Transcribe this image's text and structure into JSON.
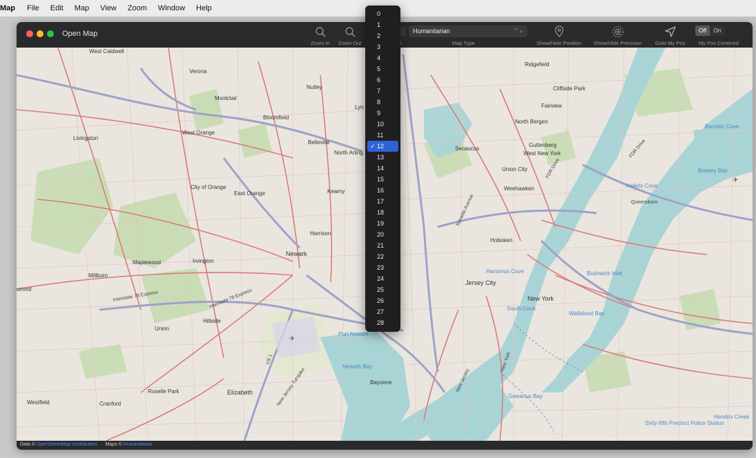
{
  "menubar": {
    "app": "Map",
    "items": [
      "File",
      "Edit",
      "Map",
      "View",
      "Zoom",
      "Window",
      "Help"
    ]
  },
  "window": {
    "title": "Open Map"
  },
  "toolbar": {
    "zoom_in": "Zoom In",
    "zoom_out": "Zoom Out",
    "map_type_value": "Humanitarian",
    "map_type_label": "Map Type",
    "show_hide_position": "Show/Hide Position",
    "show_hide_precision": "Show/Hide Precision",
    "goto_my_pos": "Goto My Pos",
    "segment_off": "Off",
    "segment_on": "On",
    "my_pos_centered": "My Pos Centered",
    "zoom_level_partial": "l"
  },
  "zoom_dropdown": {
    "selected": "12",
    "check": "✓",
    "options": [
      "0",
      "1",
      "2",
      "3",
      "4",
      "5",
      "6",
      "7",
      "8",
      "9",
      "10",
      "11",
      "12",
      "13",
      "14",
      "15",
      "16",
      "17",
      "18",
      "19",
      "20",
      "21",
      "22",
      "23",
      "24",
      "25",
      "26",
      "27",
      "28"
    ]
  },
  "map": {
    "labels": {
      "west_caldwell": "West Caldwell",
      "verona": "Verona",
      "nutley": "Nutley",
      "montclair": "Montclair",
      "bloomfield": "Bloomfield",
      "west_orange": "West Orange",
      "livingston": "Livingston",
      "belleville": "Belleville",
      "north_arlington": "North Arling",
      "city_of_orange": "City of Orange",
      "east_orange": "East Orange",
      "kearny": "Kearny",
      "harrison": "Harrison",
      "newark": "Newark",
      "maplewood": "Maplewood",
      "irvington": "Irvington",
      "millburn": "Millburn",
      "summit": "ummit",
      "hillside": "Hillside",
      "union": "Union",
      "roselle_park": "Roselle Park",
      "elizabeth": "Elizabeth",
      "cranford": "Cranford",
      "westfield": "Westfield",
      "bayonne": "Bayonne",
      "jersey_city": "Jersey City",
      "hoboken": "Hoboken",
      "new_york": "New York",
      "ridgefield": "Ridgefield",
      "cliffside_park": "Cliffside Park",
      "fairview": "Fairview",
      "north_bergen": "North Bergen",
      "guttenberg": "Guttenberg",
      "west_new_york": "West New York",
      "secaucus": "Secaucus",
      "union_city": "Union City",
      "weehawken": "Weehawken",
      "lyndhurst": "Lyn",
      "port_newark": "Port Newark",
      "newark_bay": "Newark Bay",
      "harsimus_cove": "Harsimus Cove",
      "south_cove": "South Cove",
      "wallabout_bay": "Wallabout Bay",
      "bushwick_inlet": "Bushwick Inlet",
      "bowery_bay": "Bowery Bay",
      "hallets_cove": "Hallets Cove",
      "barretto_cove": "Barretto Cove",
      "gowanus_bay": "Gowanus Bay",
      "police_station": "Sixty-fifth Precinct Police Station",
      "hendrix_creek": "Hendrix Creek",
      "interstate_78": "Interstate 78 Express",
      "interstate_78b": "Interstate 78 Express",
      "new_jersey_turnpike": "New Jersey Turnpike",
      "route_1": "US 1",
      "new_jersey": "New Jersey",
      "new_york_river": "New York",
      "fdr": "FDR Drive",
      "fdr2": "FDR Drive",
      "queensboro": "Queensboro",
      "tonnelle": "Tonnelle Avenue",
      "humanitarian_note": "Maps ©"
    }
  },
  "status": {
    "data_prefix": "Data ©",
    "data_link": "OpenStreetMap contributors",
    "maps_prefix": "Maps ©",
    "maps_link": "Humanitarian"
  },
  "colors": {
    "titlebar": "#2a2a2c",
    "land": "#eae6df",
    "water": "#a8d4d6",
    "park": "#c9dcb3",
    "road_major": "#d97b7b",
    "highway": "#9da2c8",
    "selection": "#2f62d6"
  }
}
